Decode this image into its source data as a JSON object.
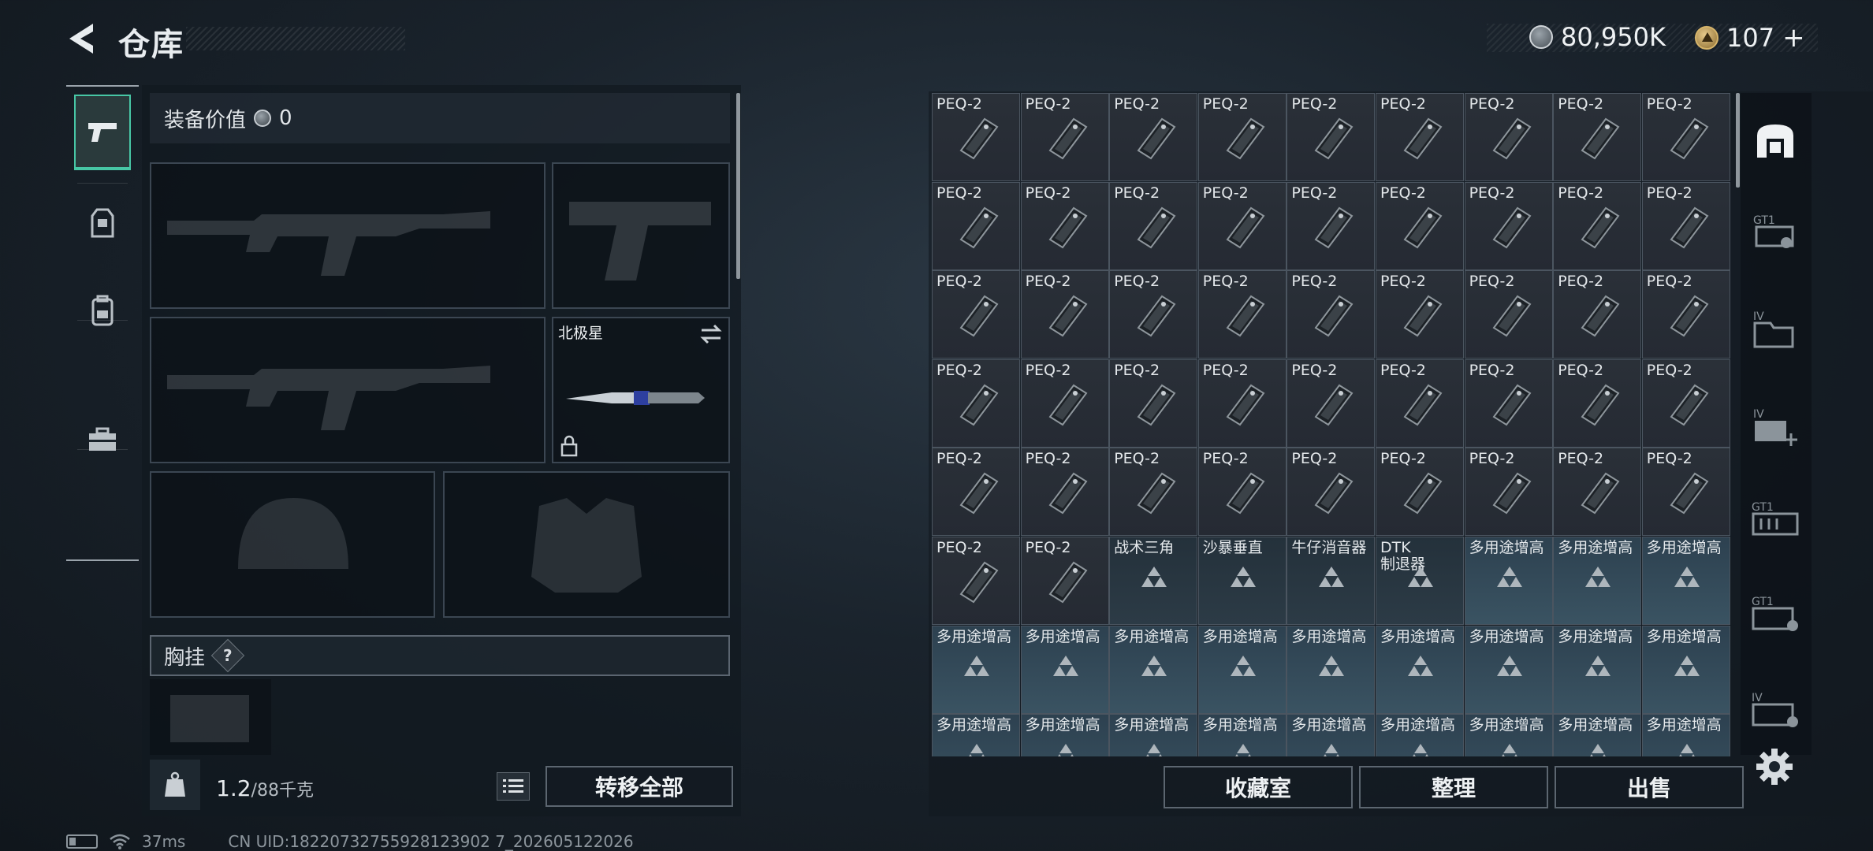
{
  "header": {
    "title": "仓库",
    "currency": {
      "silver": "80,950K",
      "gold": "107",
      "add": "+"
    }
  },
  "loadout": {
    "value_label": "装备价值",
    "value": "0",
    "knife_name": "北极星",
    "section_title": "胸挂",
    "section_help": "?",
    "weight_current": "1.2",
    "weight_max": "/88千克",
    "transfer_all": "转移全部"
  },
  "tabs": [
    "weapon-icon",
    "armor-icon",
    "backpack-icon",
    "toolbox-icon"
  ],
  "warehouse": {
    "columns": 9,
    "cells": [
      "PEQ-2",
      "PEQ-2",
      "PEQ-2",
      "PEQ-2",
      "PEQ-2",
      "PEQ-2",
      "PEQ-2",
      "PEQ-2",
      "PEQ-2",
      "PEQ-2",
      "PEQ-2",
      "PEQ-2",
      "PEQ-2",
      "PEQ-2",
      "PEQ-2",
      "PEQ-2",
      "PEQ-2",
      "PEQ-2",
      "PEQ-2",
      "PEQ-2",
      "PEQ-2",
      "PEQ-2",
      "PEQ-2",
      "PEQ-2",
      "PEQ-2",
      "PEQ-2",
      "PEQ-2",
      "PEQ-2",
      "PEQ-2",
      "PEQ-2",
      "PEQ-2",
      "PEQ-2",
      "PEQ-2",
      "PEQ-2",
      "PEQ-2",
      "PEQ-2",
      "PEQ-2",
      "PEQ-2",
      "PEQ-2",
      "PEQ-2",
      "PEQ-2",
      "PEQ-2",
      "PEQ-2",
      "PEQ-2",
      "PEQ-2",
      "PEQ-2",
      "PEQ-2",
      "战术三角",
      "沙暴垂直",
      "牛仔消音器",
      "DTK\n制退器",
      "多用途增高",
      "多用途增高",
      "多用途增高",
      "多用途增高",
      "多用途增高",
      "多用途增高",
      "多用途增高",
      "多用途增高",
      "多用途增高",
      "多用途增高",
      "多用途增高",
      "多用途增高",
      "多用途增高",
      "多用途增高",
      "多用途增高",
      "多用途增高",
      "多用途增高",
      "多用途增高",
      "多用途增高",
      "多用途增高",
      "多用途增高"
    ],
    "buttons": {
      "collection": "收藏室",
      "sort": "整理",
      "sell": "出售"
    }
  },
  "side_icons": [
    "inventory-tab-icon",
    "gt1-icon",
    "iv-icon",
    "iv-plus-icon",
    "gt1-rack-icon",
    "gt1-case-icon",
    "iv-case-icon"
  ],
  "status": {
    "ping": "37ms",
    "uid": "CN UID:18220732755928123902 7_202605122026"
  }
}
